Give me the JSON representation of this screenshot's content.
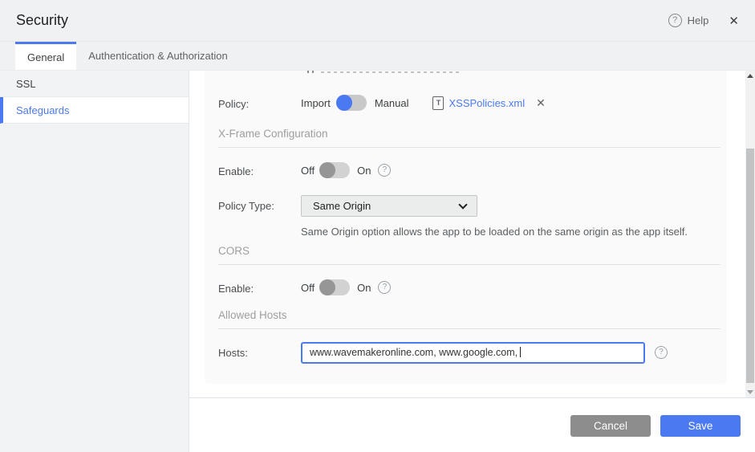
{
  "window": {
    "title": "Security",
    "help_label": "Help"
  },
  "tabs": [
    {
      "label": "General",
      "active": true
    },
    {
      "label": "Authentication & Authorization",
      "active": false
    }
  ],
  "sidebar": {
    "items": [
      {
        "label": "SSL",
        "selected": false
      },
      {
        "label": "Safeguards",
        "selected": true
      }
    ]
  },
  "content": {
    "policy": {
      "label": "Policy:",
      "option_left": "Import",
      "option_right": "Manual",
      "selected": "Import",
      "file_name": "XSSPolicies.xml"
    },
    "xframe": {
      "section_title": "X-Frame Configuration",
      "enable_label": "Enable:",
      "toggle_off": "Off",
      "toggle_on": "On",
      "enabled": false,
      "policy_type_label": "Policy Type:",
      "policy_type_value": "Same Origin",
      "policy_type_hint": "Same Origin option allows the app to be loaded on the same origin as the app itself."
    },
    "cors": {
      "section_title": "CORS",
      "enable_label": "Enable:",
      "toggle_off": "Off",
      "toggle_on": "On",
      "enabled": false
    },
    "allowed_hosts": {
      "section_title": "Allowed Hosts",
      "hosts_label": "Hosts:",
      "hosts_value": "www.wavemakeronline.com, www.google.com,"
    }
  },
  "footer": {
    "cancel_label": "Cancel",
    "save_label": "Save"
  },
  "icons": {
    "help": "?",
    "close": "✕",
    "remove_file": "✕",
    "file_type": "T"
  },
  "colors": {
    "accent": "#4b79f1",
    "link": "#4b79f1",
    "save_button": "#4b79f1",
    "cancel_button": "#8d8d8d"
  }
}
